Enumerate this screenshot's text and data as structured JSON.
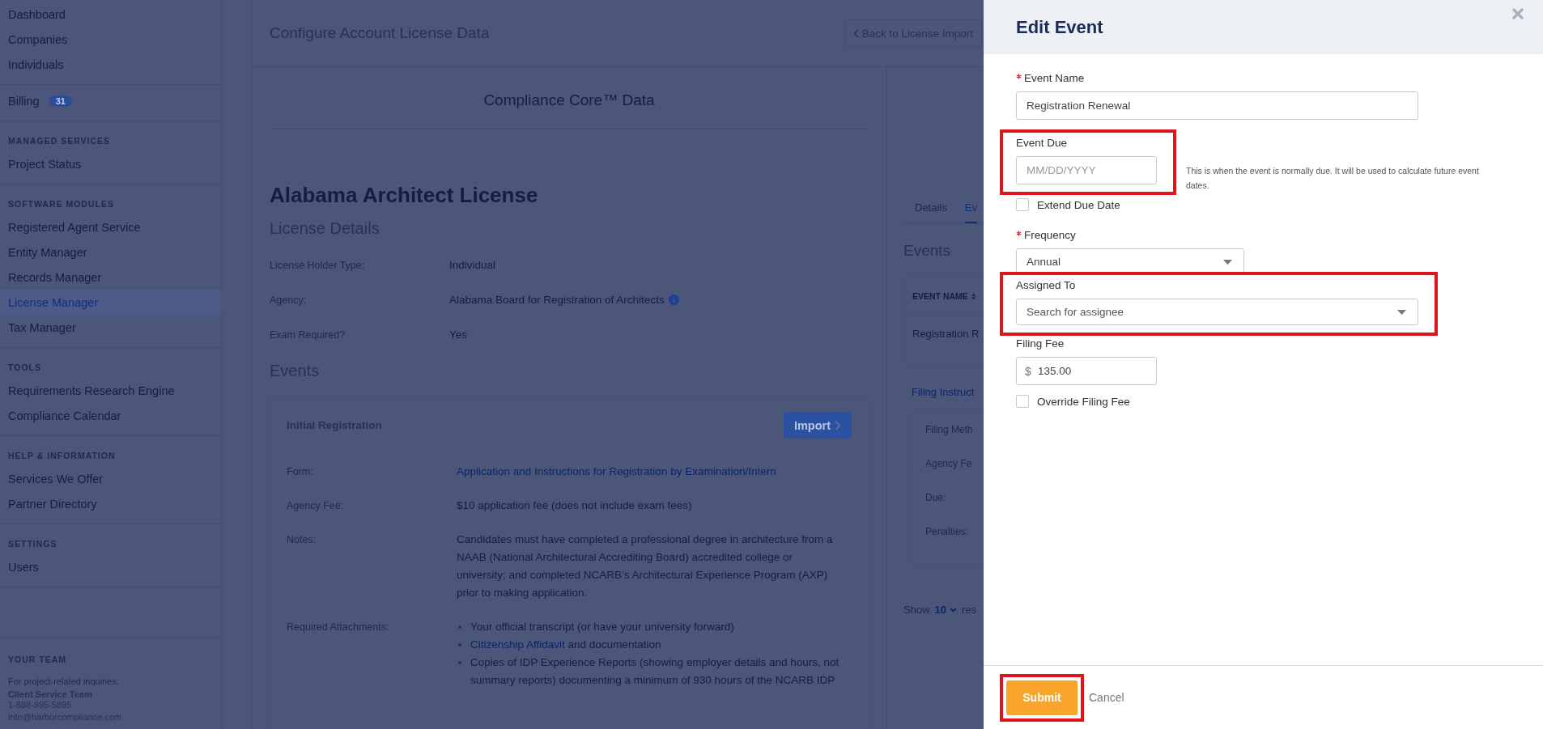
{
  "sidebar": {
    "groups": [
      {
        "items": [
          {
            "label": "Dashboard",
            "selected": false
          },
          {
            "label": "Companies",
            "selected": false
          },
          {
            "label": "Individuals",
            "selected": false
          }
        ]
      },
      {
        "items": [
          {
            "label": "Billing",
            "badge": "31",
            "selected": false
          }
        ]
      },
      {
        "heading": "MANAGED SERVICES",
        "items": [
          {
            "label": "Project Status",
            "selected": false
          }
        ]
      },
      {
        "heading": "SOFTWARE MODULES",
        "items": [
          {
            "label": "Registered Agent Service",
            "selected": false
          },
          {
            "label": "Entity Manager",
            "selected": false
          },
          {
            "label": "Records Manager",
            "selected": false
          },
          {
            "label": "License Manager",
            "selected": true
          },
          {
            "label": "Tax Manager",
            "selected": false
          }
        ]
      },
      {
        "heading": "TOOLS",
        "items": [
          {
            "label": "Requirements Research Engine",
            "selected": false
          },
          {
            "label": "Compliance Calendar",
            "selected": false
          }
        ]
      },
      {
        "heading": "HELP & INFORMATION",
        "items": [
          {
            "label": "Services We Offer",
            "selected": false
          },
          {
            "label": "Partner Directory",
            "selected": false
          }
        ]
      },
      {
        "heading": "SETTINGS",
        "items": [
          {
            "label": "Users",
            "selected": false
          }
        ]
      }
    ],
    "team": {
      "heading": "YOUR TEAM",
      "intro": "For project-related inquiries:",
      "name": "Client Service Team",
      "phone": "1-888-995-5895",
      "email": "info@harborcompliance.com"
    }
  },
  "main": {
    "title": "Configure Account License Data",
    "back_button": "Back to License Import",
    "left": {
      "heading": "Compliance Core™ Data",
      "license_title": "Alabama Architect License",
      "details_heading": "License Details",
      "details": [
        {
          "label": "License Holder Type:",
          "value": "Individual",
          "info": false
        },
        {
          "label": "Agency:",
          "value": "Alabama Board for Registration of Architects",
          "info": true
        },
        {
          "label": "Exam Required?",
          "value": "Yes",
          "info": false
        }
      ],
      "events_heading": "Events",
      "event_card": {
        "title": "Initial Registration",
        "import_button": "Import",
        "rows": [
          {
            "kind": "link",
            "label": "Form:",
            "value": "Application and Instructions for Registration by Examination/Intern"
          },
          {
            "kind": "text",
            "label": "Agency Fee:",
            "value": "$10 application fee (does not include exam fees)"
          },
          {
            "kind": "text",
            "label": "Notes:",
            "value": "Candidates must have completed a professional degree in architecture from a NAAB (National Architectural Accrediting Board) accredited college or university; and completed NCARB’s Architectural Experience Program (AXP) prior to making application."
          },
          {
            "kind": "list",
            "label": "Required Attachments:",
            "items": [
              {
                "text": "Your official transcript (or have your university forward)"
              },
              {
                "link": "Citizenship Affidavit",
                "text": "and documentation"
              },
              {
                "text": "Copies of IDP Experience Reports (showing employer details and hours, not summary reports) documenting a minimum of 930 hours of the NCARB IDP"
              }
            ]
          }
        ]
      }
    },
    "right": {
      "tabs": [
        {
          "label": "Details",
          "selected": false
        },
        {
          "label": "Ev",
          "selected": true
        }
      ],
      "events_heading": "Events",
      "table": {
        "columns": [
          "EVENT NAME"
        ],
        "rows": [
          [
            "Registration R"
          ]
        ]
      },
      "link": "Filing Instruct",
      "detail_labels": [
        "Filing Meth",
        "Agency Fe",
        "Due:",
        "Penalties:"
      ],
      "show_label": "Show",
      "page_size": "10",
      "results_label": "res"
    }
  },
  "modal": {
    "title": "Edit Event",
    "fields": [
      {
        "kind": "text",
        "label": "Event Name",
        "required": true,
        "value": "Registration Renewal",
        "highlighted": false
      },
      {
        "kind": "date",
        "label": "Event Due",
        "required": false,
        "placeholder": "MM/DD/YYYY",
        "help": "This is when the event is normally due. It will be used to calculate future event dates.",
        "highlighted": true
      },
      {
        "kind": "checkbox",
        "label": "Extend Due Date",
        "checked": false
      },
      {
        "kind": "select",
        "label": "Frequency",
        "required": true,
        "value": "Annual",
        "highlighted": false
      },
      {
        "kind": "select",
        "label": "Assigned To",
        "required": false,
        "placeholder": "Search for assignee",
        "highlighted": true
      },
      {
        "kind": "money",
        "label": "Filing Fee",
        "required": false,
        "prefix": "$",
        "value": "135.00",
        "highlighted": false
      },
      {
        "kind": "checkbox",
        "label": "Override Filing Fee",
        "checked": false
      }
    ],
    "submit": {
      "label": "Submit",
      "highlighted": true
    },
    "cancel": "Cancel"
  }
}
